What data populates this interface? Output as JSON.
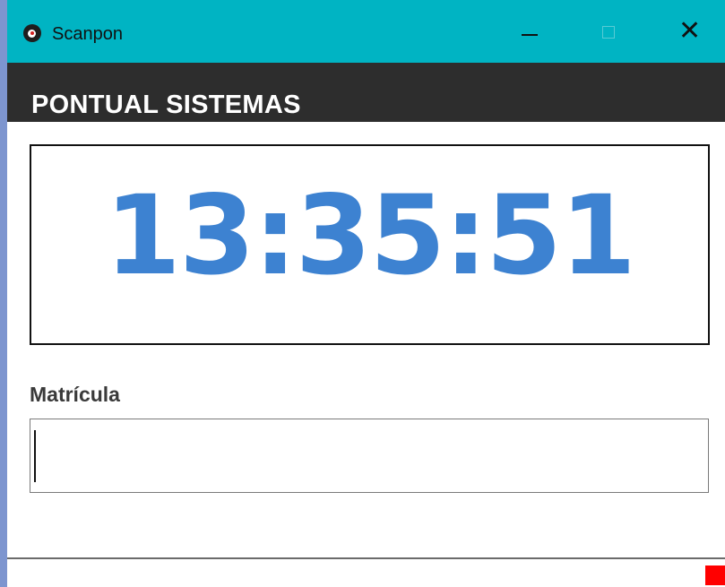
{
  "window": {
    "title": "Scanpon",
    "icon": "scanpon-app-icon",
    "minimize_icon": "minimize-icon",
    "maximize_icon": "maximize-icon",
    "close_glyph": "✕"
  },
  "header": {
    "brand": "PONTUAL SISTEMAS"
  },
  "clock": {
    "time": "13:35:51",
    "color": "#3d82d1"
  },
  "form": {
    "matricula_label": "Matrícula",
    "matricula_value": "",
    "matricula_placeholder": ""
  },
  "status": {
    "indicator_color": "#ff0000"
  },
  "colors": {
    "titlebar": "#00b4c3",
    "header": "#2d2d2d"
  }
}
